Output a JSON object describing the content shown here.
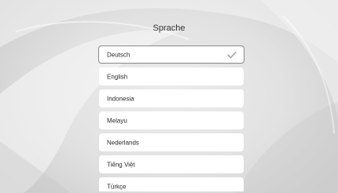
{
  "page": {
    "title": "Sprache"
  },
  "languages": [
    {
      "label": "Deutsch",
      "selected": true
    },
    {
      "label": "English",
      "selected": false
    },
    {
      "label": "Indonesia",
      "selected": false
    },
    {
      "label": "Melayu",
      "selected": false
    },
    {
      "label": "Nederlands",
      "selected": false
    },
    {
      "label": "Tiếng Việt",
      "selected": false
    },
    {
      "label": "Türkçe",
      "selected": false
    }
  ],
  "icons": {
    "selected_marker": "check-icon"
  },
  "colors": {
    "background": "#dcdcdc",
    "item_background": "#ffffff",
    "selected_border": "#8a8a8a",
    "text": "#2b2b2b"
  }
}
